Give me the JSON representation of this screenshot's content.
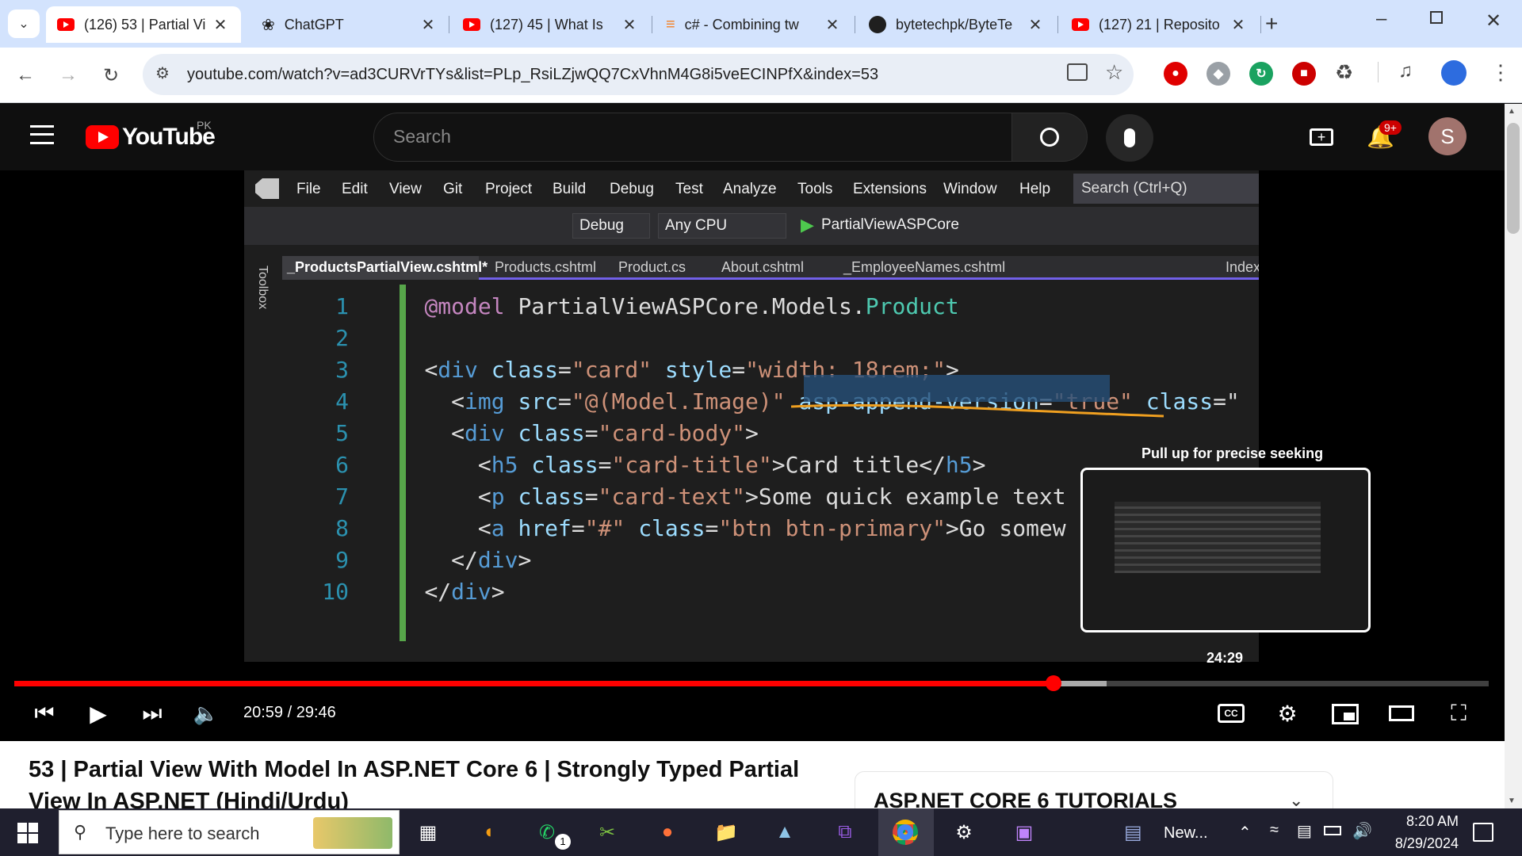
{
  "tabs": [
    {
      "title": "(126) 53 | Partial Vi",
      "icon": "youtube-icon"
    },
    {
      "title": "ChatGPT",
      "icon": "chatgpt-icon"
    },
    {
      "title": "(127) 45 | What Is",
      "icon": "youtube-icon"
    },
    {
      "title": "c# - Combining tw",
      "icon": "stackoverflow-icon"
    },
    {
      "title": "bytetechpk/ByteTe",
      "icon": "github-icon"
    },
    {
      "title": "(127) 21 | Reposito",
      "icon": "youtube-icon"
    }
  ],
  "new_tab": "+",
  "address": {
    "url": "youtube.com/watch?v=ad3CURVrTYs&list=PLp_RsiLZjwQQ7CxVhnM4G8i5veECINPfX&index=53"
  },
  "youtube": {
    "logo": "YouTube",
    "country": "PK",
    "search_placeholder": "Search",
    "notif_count": "9+",
    "avatar_letter": "S"
  },
  "vs": {
    "menu": [
      "File",
      "Edit",
      "View",
      "Git",
      "Project",
      "Build",
      "Debug",
      "Test",
      "Analyze",
      "Tools",
      "Extensions",
      "Window",
      "Help"
    ],
    "search": "Search (Ctrl+Q)",
    "config": "Debug",
    "platform": "Any CPU",
    "run_target": "PartialViewASPCore",
    "toolbox": "Toolbox",
    "doc_tabs": [
      "_ProductsPartialView.cshtml*",
      "Products.cshtml",
      "Product.cs",
      "About.cshtml",
      "_EmployeeNames.cshtml",
      "Index.cshtr"
    ],
    "code": [
      {
        "n": "1",
        "parts": [
          [
            "rz",
            "@model "
          ],
          [
            "tx",
            "PartialViewASPCore.Models."
          ],
          [
            "ty",
            "Product"
          ]
        ]
      },
      {
        "n": "2",
        "parts": []
      },
      {
        "n": "3",
        "parts": [
          [
            "tx",
            "<"
          ],
          [
            "kw",
            "div "
          ],
          [
            "at",
            "class"
          ],
          [
            "tx",
            "="
          ],
          [
            "st",
            "\"card\" "
          ],
          [
            "at",
            "style"
          ],
          [
            "tx",
            "="
          ],
          [
            "st",
            "\"width: 18rem;\""
          ],
          [
            "tx",
            ">"
          ]
        ]
      },
      {
        "n": "4",
        "parts": [
          [
            "tx",
            "  <"
          ],
          [
            "kw",
            "img "
          ],
          [
            "at",
            "src"
          ],
          [
            "tx",
            "="
          ],
          [
            "st",
            "\"@(Model.Image)\" "
          ],
          [
            "at",
            "asp-append-version"
          ],
          [
            "tx",
            "="
          ],
          [
            "st",
            "\"true\" "
          ],
          [
            "at",
            "class"
          ],
          [
            "tx",
            "=\""
          ]
        ]
      },
      {
        "n": "5",
        "parts": [
          [
            "tx",
            "  <"
          ],
          [
            "kw",
            "div "
          ],
          [
            "at",
            "class"
          ],
          [
            "tx",
            "="
          ],
          [
            "st",
            "\"card-body\""
          ],
          [
            "tx",
            ">"
          ]
        ]
      },
      {
        "n": "6",
        "parts": [
          [
            "tx",
            "    <"
          ],
          [
            "kw",
            "h5 "
          ],
          [
            "at",
            "class"
          ],
          [
            "tx",
            "="
          ],
          [
            "st",
            "\"card-title\""
          ],
          [
            "tx",
            ">Card title</"
          ],
          [
            "kw",
            "h5"
          ],
          [
            "tx",
            ">"
          ]
        ]
      },
      {
        "n": "7",
        "parts": [
          [
            "tx",
            "    <"
          ],
          [
            "kw",
            "p "
          ],
          [
            "at",
            "class"
          ],
          [
            "tx",
            "="
          ],
          [
            "st",
            "\"card-text\""
          ],
          [
            "tx",
            ">Some quick example text"
          ]
        ]
      },
      {
        "n": "8",
        "parts": [
          [
            "tx",
            "    <"
          ],
          [
            "kw",
            "a "
          ],
          [
            "at",
            "href"
          ],
          [
            "tx",
            "="
          ],
          [
            "st",
            "\"#\" "
          ],
          [
            "at",
            "class"
          ],
          [
            "tx",
            "="
          ],
          [
            "st",
            "\"btn btn-primary\""
          ],
          [
            "tx",
            ">Go somew"
          ]
        ]
      },
      {
        "n": "9",
        "parts": [
          [
            "tx",
            "  </"
          ],
          [
            "kw",
            "div"
          ],
          [
            "tx",
            ">"
          ]
        ]
      },
      {
        "n": "10",
        "parts": [
          [
            "tx",
            "</"
          ],
          [
            "kw",
            "div"
          ],
          [
            "tx",
            ">"
          ]
        ]
      }
    ]
  },
  "player": {
    "seek_hint": "Pull up for precise seeking",
    "preview_time": "24:29",
    "time": "20:59 / 29:46",
    "progress": 0.705,
    "buffered": 0.741
  },
  "video": {
    "title_line1": "53 | Partial View With Model In ASP.NET Core 6 | Strongly Typed Partial",
    "title_line2": "View In ASP.NET (Hindi/Urdu)",
    "playlist": "ASP.NET CORE 6 TUTORIALS"
  },
  "taskbar": {
    "search_placeholder": "Type here to search",
    "news": "New...",
    "time": "8:20 AM",
    "date": "8/29/2024",
    "whatsapp_badge": "1"
  }
}
